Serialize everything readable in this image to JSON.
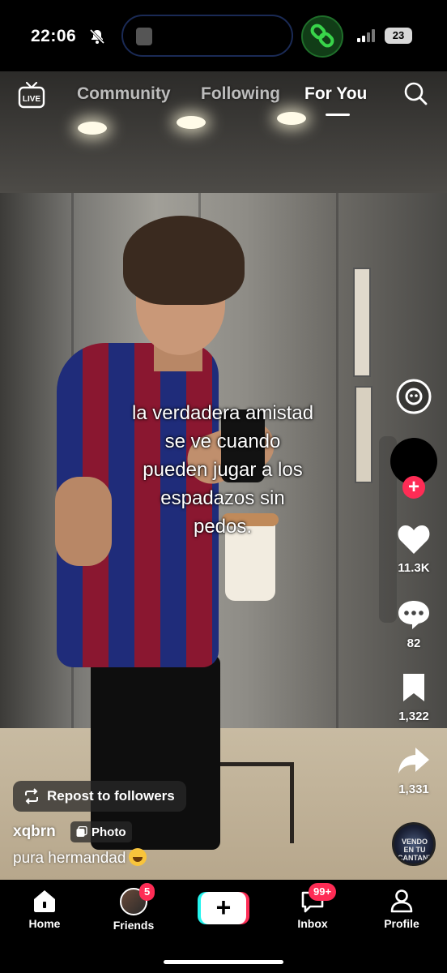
{
  "status_bar": {
    "time": "22:06",
    "battery": "23",
    "icons": [
      "bell-slash-icon",
      "link-icon",
      "signal-icon",
      "battery-icon"
    ]
  },
  "top_nav": {
    "tabs": [
      {
        "label": "Community",
        "active": false
      },
      {
        "label": "Following",
        "active": false
      },
      {
        "label": "For You",
        "active": true
      }
    ],
    "live_label": "LIVE"
  },
  "post": {
    "overlay_text": [
      "la verdadera amistad",
      "se ve cuando",
      "pueden jugar a los",
      "espadazos sin",
      "pedos."
    ],
    "username": "xqbrn",
    "type_badge": "Photo",
    "description": "pura hermandad",
    "repost_label": "Repost to followers",
    "music_disc_text": "VENDO EN TU CANTANTE"
  },
  "actions": {
    "likes": "11.3K",
    "comments": "82",
    "saves": "1,322",
    "shares": "1,331"
  },
  "bottom_nav": {
    "items": [
      {
        "label": "Home"
      },
      {
        "label": "Friends",
        "badge": "5"
      },
      {
        "label": "Inbox",
        "badge": "99+"
      },
      {
        "label": "Profile"
      }
    ]
  },
  "colors": {
    "accent": "#fe2c55",
    "cyan": "#25f4ee",
    "background": "#000000"
  }
}
